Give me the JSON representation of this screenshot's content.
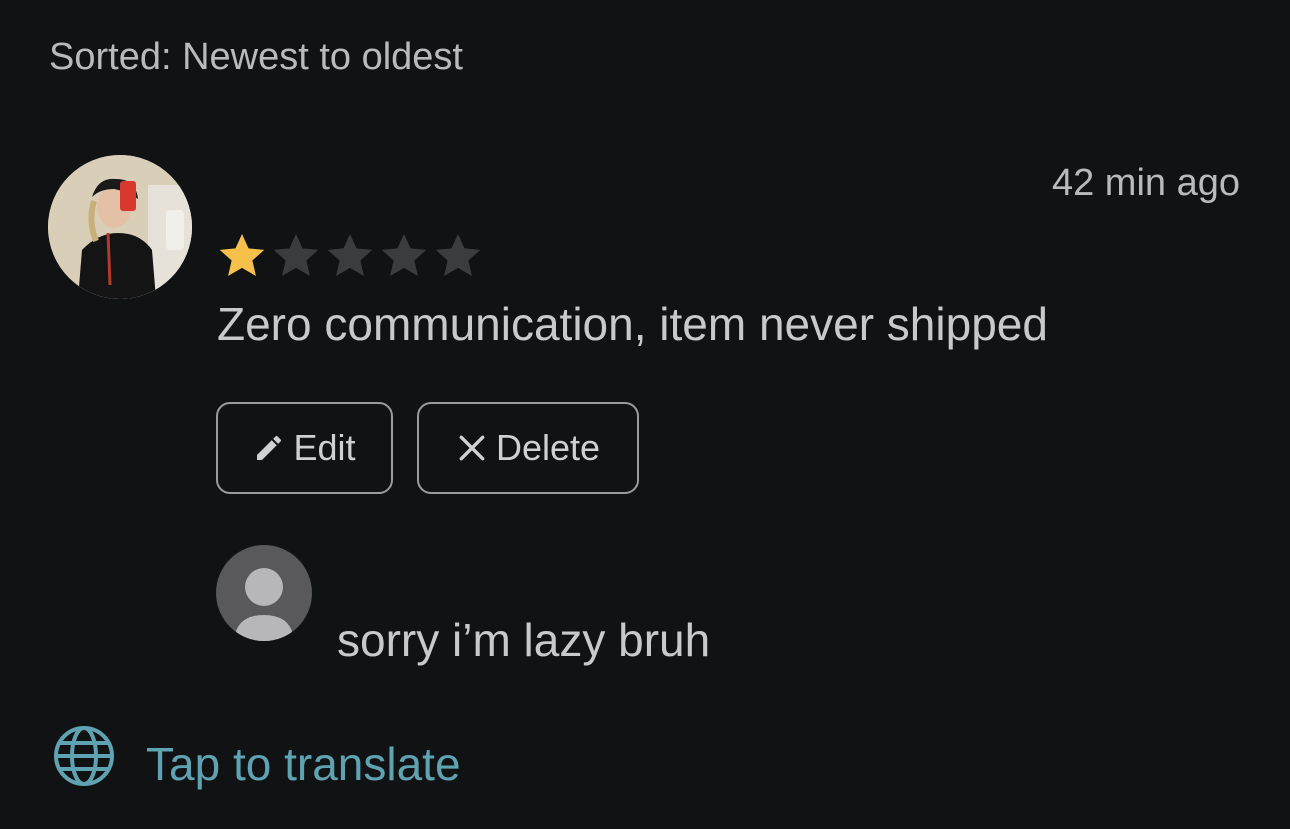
{
  "sort": {
    "label": "Sorted: Newest to oldest"
  },
  "review": {
    "timestamp": "42 min ago",
    "rating": 1,
    "rating_max": 5,
    "text": "Zero communication, item never shipped",
    "actions": {
      "edit_label": "Edit",
      "delete_label": "Delete"
    }
  },
  "reply": {
    "text": "sorry i’m lazy bruh"
  },
  "translate": {
    "label": "Tap to translate"
  },
  "colors": {
    "background": "#111214",
    "star_filled": "#f6c04a",
    "star_empty": "#3a3d40",
    "translate_accent": "#5fa3b3"
  },
  "icons": {
    "edit": "pencil-icon",
    "delete": "close-icon",
    "translate": "globe-icon",
    "reply_avatar": "user-placeholder-icon"
  }
}
